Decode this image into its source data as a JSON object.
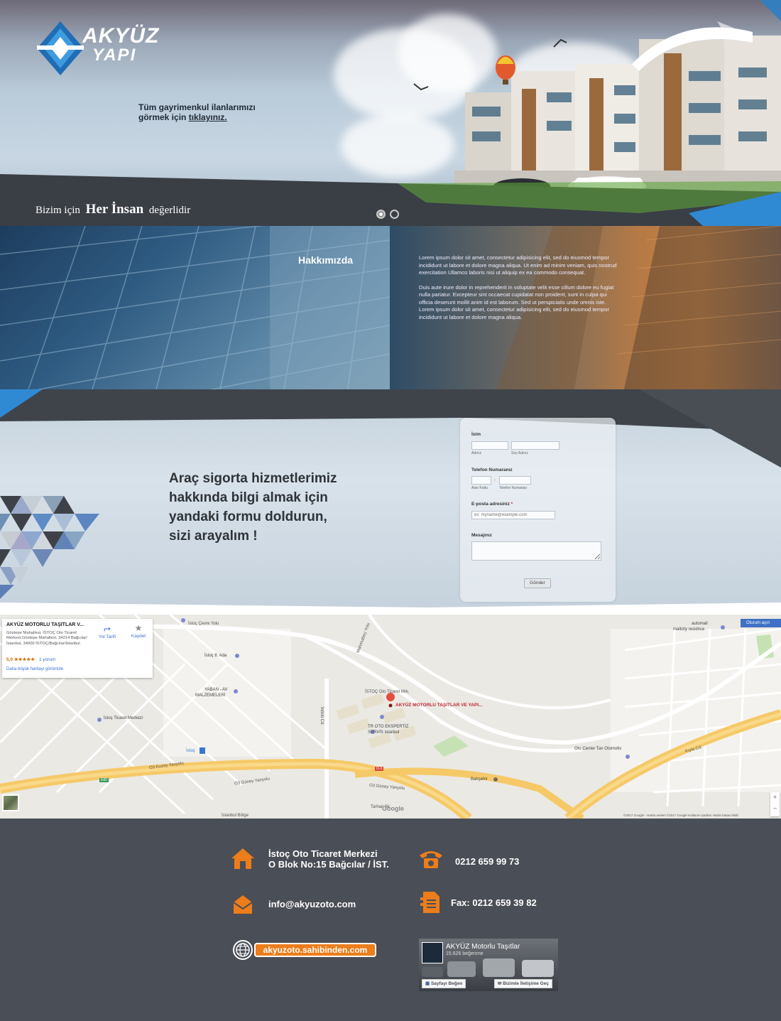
{
  "brand": {
    "line1": "AKYÜZ",
    "line2": "YAPI"
  },
  "hero": {
    "cta_text": "Tüm gayrimenkul ilanlarımızı görmek için",
    "cta_link": "tıklayınız.",
    "slogan_pre": "Bizim için",
    "slogan_big": "Her İnsan",
    "slogan_post": "değerlidir",
    "slides": 2,
    "active_slide": 1
  },
  "about": {
    "title": "Hakkımızda",
    "p1": "Lorem ipsum dolor sit amet, consectetur adipisicing elit, sed do eiusmod tempor incididunt ut labore et dolore magna aliqua. Ut enim ad minim veniam, quis nostrud exercitation Ullamco laboris nisi ut aliquip ex ea commodo consequat.",
    "p2": "Duis aute irure dolor in reprehenderit in voluptate velit esse cillum dolore eu fugiat nulla pariatur. Excepteur sint occaecat cupidatat non proident, sunt in culpa qui officia deserunt mollit anim id est laborum. Sed ut perspiciatis unde omnis iste. Lorem ipsum dolor sit amet, consectetur adipisicing elit, sed do eiusmod tempor incididunt ut labore et dolore magna aliqua."
  },
  "form_section": {
    "headline_l1": "Araç sigorta hizmetlerimiz",
    "headline_l2": "hakkında bilgi almak için",
    "headline_l3": "yandaki formu doldurun,",
    "headline_l4": "sizi arayalım !",
    "name_label": "İsim",
    "first_name_sub": "Adınız",
    "last_name_sub": "Soy Adınız",
    "phone_label": "Telefon Numaranız",
    "area_code_sub": "Alan Kodu",
    "phone_sub": "Telefon Numarası",
    "phone_sep": "-",
    "email_label": "E-posta adresiniz",
    "email_required": "*",
    "email_placeholder": "ex: myname@example.com",
    "message_label": "Mesajınız",
    "submit": "Gönder"
  },
  "map": {
    "card_title": "AKYÜZ MOTORLU TAŞITLAR V...",
    "card_address": "Göztepe Mahallesi, İSTOÇ Oto Ticaret Merkezi,Göztepe Mahallesi, 34214 Bağcılar/İstanbul, 34000 İSTOÇ/Bağcılar/İstanbul",
    "rating": "5,0 ★★★★★",
    "reviews": "1 yorum",
    "bigger_map": "Daha büyük haritayı görüntüle",
    "directions": "Yol Tarifi",
    "save": "Kaydet",
    "street_view": "Oturum açın",
    "marker_label": "AKYÜZ MOTORLU TAŞITLAR VE YAPI...",
    "google": "Google",
    "attribution": "©2017 Google - Harita verileri ©2017 Google   Kullanım Şartları   Harita hatası bildir",
    "labels": {
      "istoc_cevre": "İstoç Çevre Yolu",
      "mahmutbey": "Mahmutbey Yolu",
      "istoc8": "İstoç 8. Ada",
      "yaban": "YABAN - AV",
      "malzemeleri": "MALZEMELERİ",
      "istoc_ticaret": "İstoç Ticaret Merkezi",
      "istoc_ticaret_mh": "İSTOÇ Oto Ticaret Mrk.",
      "tr_oto": "TR OTO EKSPERTİZ",
      "servis": "SERVİS istanbul",
      "istoc_m": "İstoç",
      "kuzey": "O3 Kuzey Yanyolu",
      "guney": "O3 Güney Yanyolu",
      "guney2": "O3 Güney Yanyolu",
      "batisehir": "Batışehir",
      "oto_center": "Oto Center Tan Otomotiv",
      "automall": "automall",
      "mallcity": "mallcity residnce",
      "inonu": "İnönü Cd.",
      "kiyla": "Kıyla Cd.",
      "istanbul_bolge": "İstanbul Bölge",
      "tarhan": "Tarhan Sk.",
      "e80": "E80",
      "o3": "O-3"
    }
  },
  "footer": {
    "address_l1": "İstoç Oto Ticaret Merkezi",
    "address_l2": "O Blok No:15 Bağcılar / İST.",
    "phone": "0212 659 99 73",
    "email": "info@akyuzoto.com",
    "fax": "Fax: 0212 659 39 82",
    "website": "akyuzoto.sahibinden.com",
    "fb_title": "AKYÜZ Motorlu Taşıtlar",
    "fb_likes": "15.626 beğenme",
    "fb_like_btn": "Sayfayı Beğen",
    "fb_contact_btn": "Bizimle İletişime Geç"
  },
  "colors": {
    "accent_orange": "#ec7d1a",
    "footer_bg": "#4a4e56",
    "brand_blue": "#2f8ad3"
  }
}
